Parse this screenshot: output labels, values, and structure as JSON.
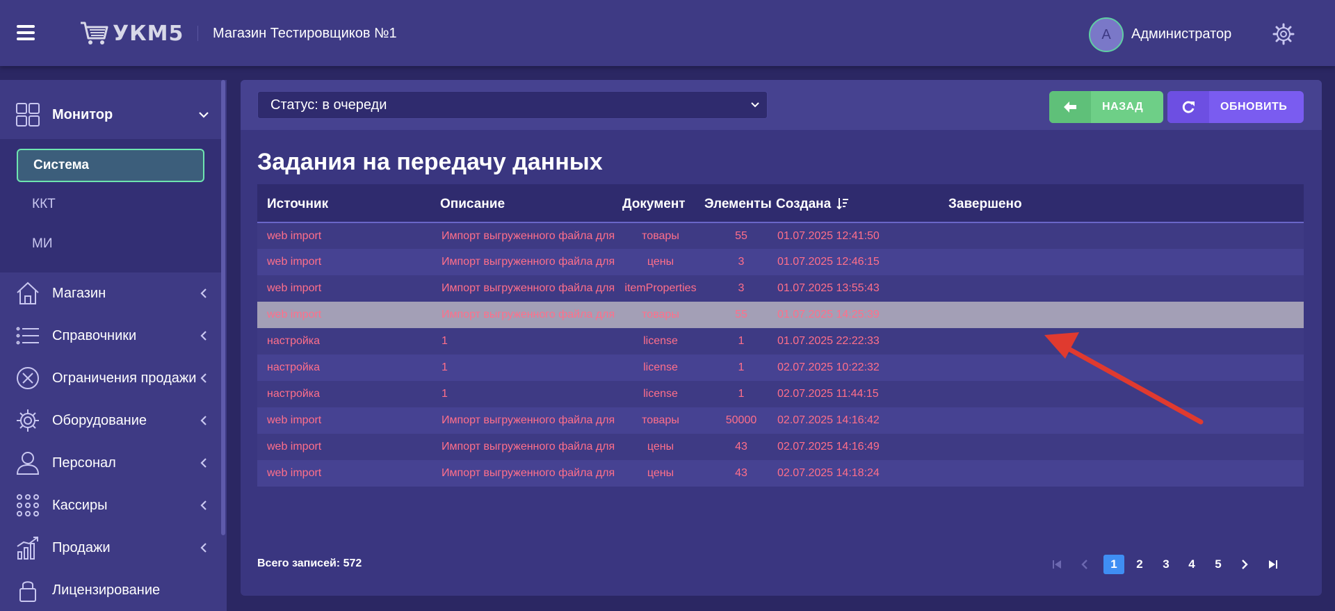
{
  "header": {
    "logo_text": "УКМ5",
    "store_name": "Магазин Тестировщиков №1",
    "avatar_letter": "А",
    "user_name": "Администратор"
  },
  "sidebar": {
    "items": [
      {
        "label": "Монитор",
        "icon": "grid-icon"
      },
      {
        "label": "Магазин",
        "icon": "house-icon"
      },
      {
        "label": "Справочники",
        "icon": "list-icon"
      },
      {
        "label": "Ограничения продажи",
        "icon": "x-circle-icon"
      },
      {
        "label": "Оборудование",
        "icon": "gear-icon"
      },
      {
        "label": "Персонал",
        "icon": "person-icon"
      },
      {
        "label": "Кассиры",
        "icon": "dots-grid-icon"
      },
      {
        "label": "Продажи",
        "icon": "bar-chart-icon"
      },
      {
        "label": "Лицензирование",
        "icon": "lock-icon"
      }
    ],
    "submenu": [
      "Система",
      "ККТ",
      "МИ"
    ]
  },
  "toolbar": {
    "status_value": "Статус: в очереди",
    "back_label": "НАЗАД",
    "refresh_label": "ОБНОВИТЬ"
  },
  "main": {
    "title": "Задания на передачу данных",
    "columns": [
      "Источник",
      "Описание",
      "Документ",
      "Элементы",
      "Создана",
      "Завершено"
    ],
    "rows": [
      {
        "source": "web import",
        "description": "Импорт выгруженного файла для запрос",
        "document": "товары",
        "elements": "55",
        "created": "01.07.2025 12:41:50",
        "finished": ""
      },
      {
        "source": "web import",
        "description": "Импорт выгруженного файла для запрос",
        "document": "цены",
        "elements": "3",
        "created": "01.07.2025 12:46:15",
        "finished": ""
      },
      {
        "source": "web import",
        "description": "Импорт выгруженного файла для запрос",
        "document": "itemProperties",
        "elements": "3",
        "created": "01.07.2025 13:55:43",
        "finished": ""
      },
      {
        "source": "web import",
        "description": "Импорт выгруженного файла для запрос",
        "document": "товары",
        "elements": "55",
        "created": "01.07.2025 14:25:39",
        "finished": ""
      },
      {
        "source": "настройка",
        "description": "1",
        "document": "license",
        "elements": "1",
        "created": "01.07.2025 22:22:33",
        "finished": ""
      },
      {
        "source": "настройка",
        "description": "1",
        "document": "license",
        "elements": "1",
        "created": "02.07.2025 10:22:32",
        "finished": ""
      },
      {
        "source": "настройка",
        "description": "1",
        "document": "license",
        "elements": "1",
        "created": "02.07.2025 11:44:15",
        "finished": ""
      },
      {
        "source": "web import",
        "description": "Импорт выгруженного файла для запрос",
        "document": "товары",
        "elements": "50000",
        "created": "02.07.2025 14:16:42",
        "finished": ""
      },
      {
        "source": "web import",
        "description": "Импорт выгруженного файла для запрос",
        "document": "цены",
        "elements": "43",
        "created": "02.07.2025 14:16:49",
        "finished": ""
      },
      {
        "source": "web import",
        "description": "Импорт выгруженного файла для запрос",
        "document": "цены",
        "elements": "43",
        "created": "02.07.2025 14:18:24",
        "finished": ""
      }
    ],
    "highlighted_row": 3,
    "total_label": "Всего записей: 572",
    "pages": [
      "1",
      "2",
      "3",
      "4",
      "5"
    ],
    "current_page": "1"
  },
  "colors": {
    "header_bg": "#3e3a84",
    "page_bg": "#2b2763",
    "accent_green": "#6ecf87",
    "accent_purple": "#7a5cf0",
    "row_text": "#ff6f8a",
    "annotation_arrow": "#e03a2f"
  }
}
